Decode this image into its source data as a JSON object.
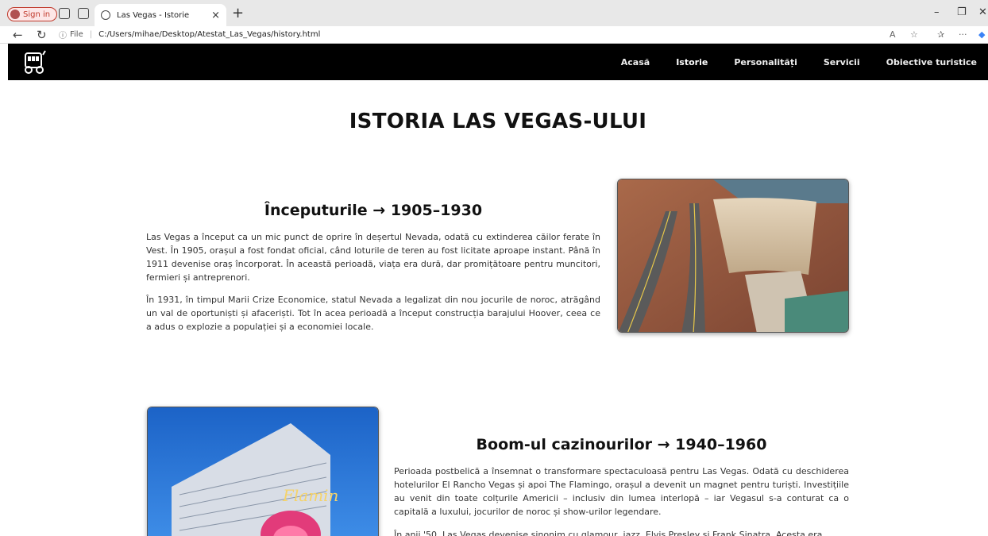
{
  "browser": {
    "signin_label": "Sign in",
    "tab_title": "Las Vegas - Istorie",
    "tab_close": "×",
    "new_tab": "+",
    "file_label": "File",
    "url": "C:/Users/mihae/Desktop/Atestat_Las_Vegas/history.html",
    "minimize": "–",
    "restore": "❐",
    "close": "✕"
  },
  "nav": {
    "items": [
      "Acasă",
      "Istorie",
      "Personalități",
      "Servicii",
      "Obiective turistice"
    ],
    "active": "Istorie"
  },
  "page": {
    "title": "ISTORIA LAS VEGAS-ULUI",
    "sections": [
      {
        "title": "Începuturile → 1905–1930",
        "p1": "Las Vegas a început ca un mic punct de oprire în deșertul Nevada, odată cu extinderea căilor ferate în Vest. În 1905, orașul a fost fondat oficial, când loturile de teren au fost licitate aproape instant. Până în 1911 devenise oraș încorporat. În această perioadă, viața era dură, dar promițătoare pentru muncitori, fermieri și antreprenori.",
        "p2": "În 1931, în timpul Marii Crize Economice, statul Nevada a legalizat din nou jocurile de noroc, atrăgând un val de oportuniști și afaceriști. Tot în acea perioadă a început construcția barajului Hoover, ceea ce a adus o explozie a populației și a economiei locale."
      },
      {
        "title": "Boom-ul cazinourilor → 1940–1960",
        "p1": "Perioada postbelică a însemnat o transformare spectaculoasă pentru Las Vegas. Odată cu deschiderea hotelurilor El Rancho Vegas și apoi The Flamingo, orașul a devenit un magnet pentru turiști. Investițiile au venit din toate colțurile Americii – inclusiv din lumea interlopă – iar Vegasul s-a conturat ca o capitală a luxului, jocurilor de noroc și show-urilor legendare.",
        "p2": "În anii '50, Las Vegas devenise sinonim cu glamour, jazz, Elvis Presley și Frank Sinatra. Acesta era"
      }
    ]
  }
}
